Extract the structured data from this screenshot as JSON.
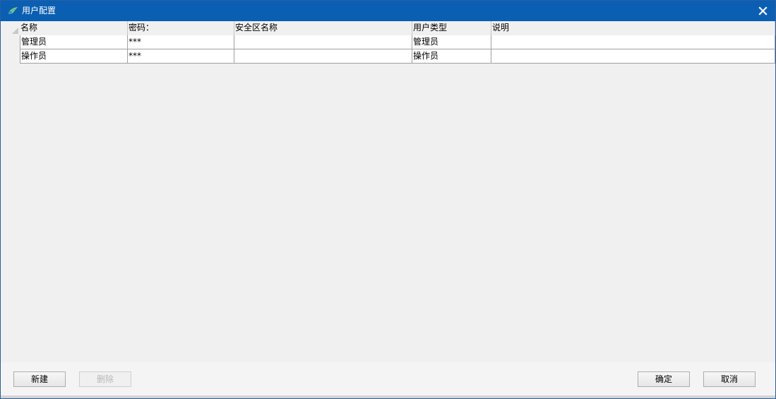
{
  "window": {
    "title": "用户配置",
    "close_label": "X",
    "title_icon": "app-logo-icon"
  },
  "grid": {
    "columns": [
      "名称",
      "密码：",
      "安全区名称",
      "用户类型",
      "说明"
    ],
    "rows": [
      [
        "管理员",
        "***",
        "",
        "管理员",
        ""
      ],
      [
        "操作员",
        "***",
        "",
        "操作员",
        ""
      ]
    ]
  },
  "buttons": {
    "new_label": "新建",
    "delete_label": "删除",
    "ok_label": "确定",
    "cancel_label": "取消"
  },
  "colors": {
    "titlebar": "#0a5fb3",
    "background": "#f0f0f0",
    "grid_line": "#a0a0a0"
  }
}
